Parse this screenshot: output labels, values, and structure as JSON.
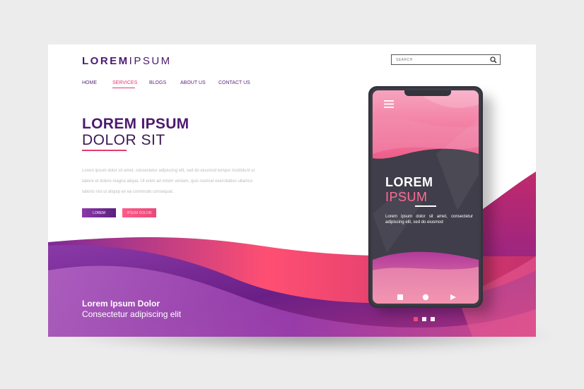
{
  "logo": {
    "bold": "LOREM",
    "light": "IPSUM"
  },
  "search": {
    "placeholder": "SEARCH",
    "icon": "search-icon"
  },
  "nav": {
    "items": [
      "HOME",
      "SERVICES",
      "BLOGS",
      "ABOUT US",
      "CONTACT US"
    ],
    "active_index": 1
  },
  "hero": {
    "title": "LOREM IPSUM",
    "subtitle": "DOLOR SIT",
    "paragraph": "Lorem ipsum dolor sit amet, consectetur adipiscing elit, sed do eiusmod tempor incididunt ut labore et dolore magna aliqua. Ut enim ad minim veniam, quis nostrud exercitation ullamco laboris nisi ut aliquip ex ea commodo consequat.",
    "button_primary": "LOREM",
    "button_secondary": "IPSUM DOLOR"
  },
  "footer": {
    "title": "Lorem Ipsum Dolor",
    "subtitle": "Consectetur adipiscing elit"
  },
  "pager": {
    "count": 3,
    "active_index": 0
  },
  "phone": {
    "title_line1": "LOREM",
    "title_line2": "IPSUM",
    "text": "Lorem ipsum dolor sit amet, consectetur adipiscing elit, sed do eiusmod",
    "controls": [
      "stop-icon",
      "home-circle-icon",
      "back-triangle-icon"
    ],
    "menu_icon": "hamburger-menu-icon"
  },
  "colors": {
    "purple_dark": "#4d1a6f",
    "purple": "#7b2a97",
    "pink": "#e43b6e",
    "phone_body": "#3d3d47"
  }
}
